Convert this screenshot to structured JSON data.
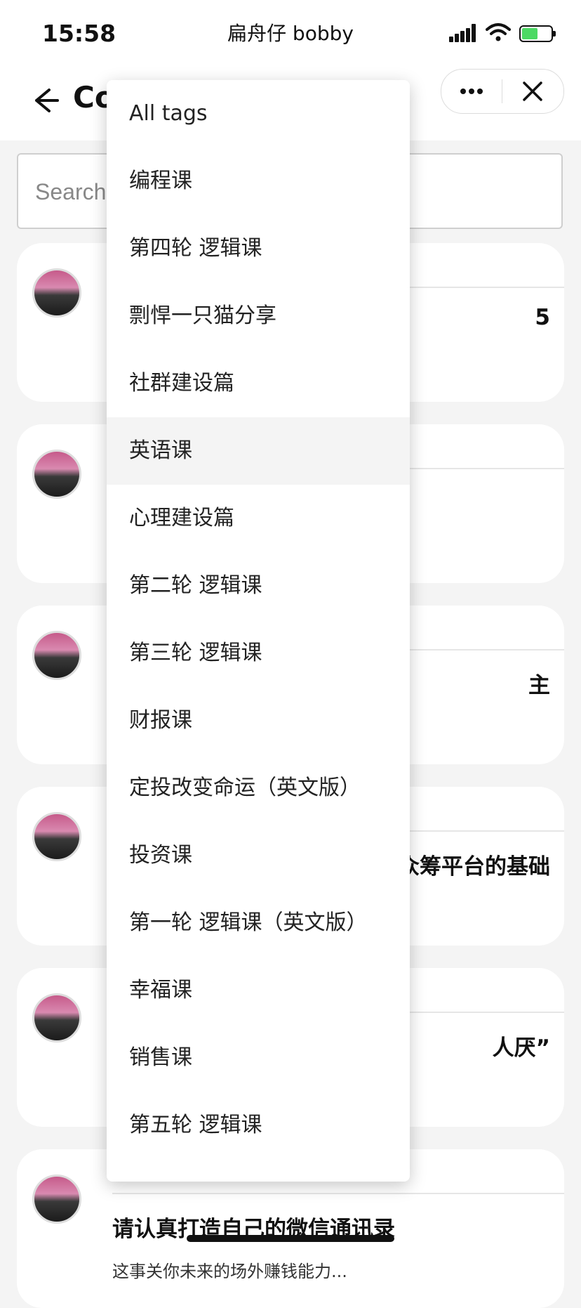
{
  "status_bar": {
    "time": "15:58",
    "title": "扁舟仔 bobby",
    "battery_color": "#4cd964"
  },
  "header": {
    "title": "Co",
    "more_icon": "more-dots-icon",
    "close_icon": "close-icon"
  },
  "search": {
    "placeholder": "Search"
  },
  "cards": [
    {
      "title": "5",
      "desc": ""
    },
    {
      "title": "",
      "desc": ""
    },
    {
      "title": "主",
      "desc": ""
    },
    {
      "title": "众筹平台的基础",
      "desc": ""
    },
    {
      "title": "人厌”",
      "desc": ""
    },
    {
      "title": "请认真打造自己的微信通讯录",
      "desc": "这事关你未来的场外赚钱能力..."
    }
  ],
  "dropdown": {
    "selected_index": 5,
    "items": [
      "All tags",
      "编程课",
      "第四轮 逻辑课",
      "剽悍一只猫分享",
      "社群建设篇",
      "英语课",
      "心理建设篇",
      "第二轮 逻辑课",
      "第三轮 逻辑课",
      "财报课",
      "定投改变命运（英文版）",
      "投资课",
      "第一轮 逻辑课（英文版）",
      "幸福课",
      "销售课",
      "第五轮 逻辑课"
    ]
  }
}
